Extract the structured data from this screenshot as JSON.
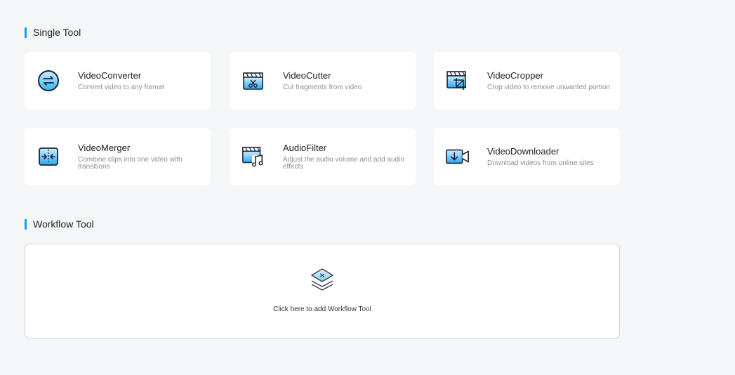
{
  "single_tool": {
    "title": "Single Tool",
    "tools": [
      {
        "name": "VideoConverter",
        "desc": "Convert video to any format",
        "icon": "convert-icon"
      },
      {
        "name": "VideoCutter",
        "desc": "Cut fragments from video",
        "icon": "scissors-clapper-icon"
      },
      {
        "name": "VideoCropper",
        "desc": "Crop video to remove unwanted portion",
        "icon": "crop-clapper-icon"
      },
      {
        "name": "VideoMerger",
        "desc": "Combine clips into one video with transitions",
        "icon": "merge-icon"
      },
      {
        "name": "AudioFilter",
        "desc": "Adjust the audio volume and add audio effects",
        "icon": "music-clapper-icon"
      },
      {
        "name": "VideoDownloader",
        "desc": "Download videos from online sites",
        "icon": "download-camera-icon"
      }
    ]
  },
  "workflow_tool": {
    "title": "Workflow Tool",
    "add_label": "Click here to add Workflow Tool",
    "icon": "layers-add-icon"
  },
  "colors": {
    "accent": "#1a9bf0",
    "icon_blue": "#2aa7f2",
    "card_bg": "#ffffff",
    "page_bg": "#f5f6f8"
  }
}
